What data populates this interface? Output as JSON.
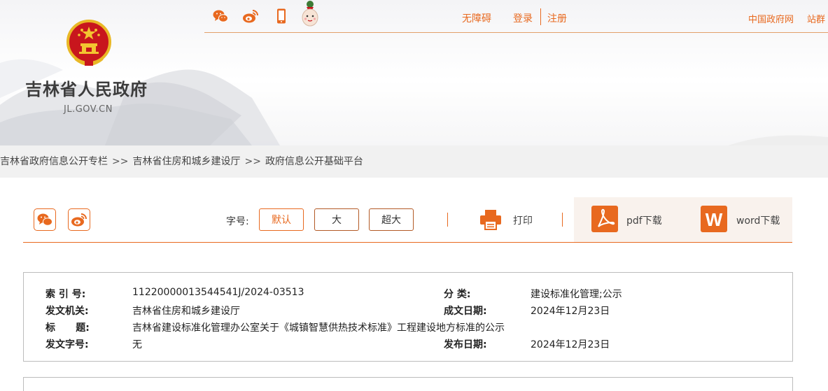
{
  "header": {
    "site_title": "吉林省人民政府",
    "site_domain": "JL.GOV.CN",
    "accessibility_label": "无障碍",
    "login_label": "登录",
    "register_label": "注册",
    "gov_portal_label": "中国政府网",
    "station_group_label": "站群",
    "icons": [
      "wechat-icon",
      "weibo-icon",
      "mobile-icon",
      "mascot-icon"
    ]
  },
  "breadcrumb": {
    "items": [
      "吉林省政府信息公开专栏",
      "吉林省住房和城乡建设厅",
      "政府信息公开基础平台"
    ],
    "separator": ">>"
  },
  "toolbar": {
    "font_size_label": "字号:",
    "font_sizes": [
      "默认",
      "大",
      "超大"
    ],
    "print_label": "打印",
    "pdf_label": "pdf下载",
    "word_label": "word下载",
    "share_icons": [
      "wechat-icon",
      "weibo-icon"
    ]
  },
  "info": {
    "index_label": "索  引  号:",
    "index_value": "11220000013544541J/2024-03513",
    "category_label": "分      类:",
    "category_value": "建设标准化管理;公示",
    "issuer_label": "发文机关:",
    "issuer_value": "吉林省住房和城乡建设厅",
    "written_date_label": "成文日期:",
    "written_date_value": "2024年12月23日",
    "title_label": "标      题:",
    "title_value": "吉林省建设标准化管理办公室关于《城镇智慧供热技术标准》工程建设地方标准的公示",
    "doc_number_label": "发文字号:",
    "doc_number_value": "无",
    "publish_date_label": "发布日期:",
    "publish_date_value": "2024年12月23日"
  },
  "colors": {
    "accent": "#e8691f",
    "breadcrumb_bg": "#f1f1f1",
    "download_panel_bg": "#f9f2ed",
    "pdf_red": "#e8691f",
    "word_orange": "#e8691f"
  }
}
